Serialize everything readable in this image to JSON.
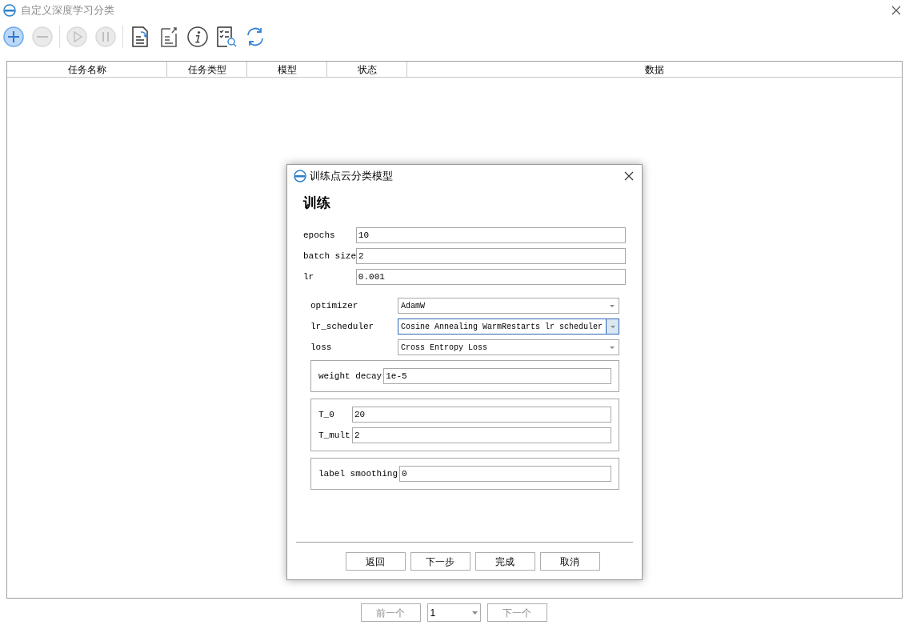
{
  "window": {
    "title": "自定义深度学习分类"
  },
  "toolbar": [
    {
      "kind": "add",
      "disabled": false
    },
    {
      "kind": "remove",
      "disabled": true
    },
    {
      "kind": "sep"
    },
    {
      "kind": "play",
      "disabled": true
    },
    {
      "kind": "pause",
      "disabled": true
    },
    {
      "kind": "sep"
    },
    {
      "kind": "import",
      "disabled": false
    },
    {
      "kind": "export",
      "disabled": false
    },
    {
      "kind": "info",
      "disabled": false
    },
    {
      "kind": "review",
      "disabled": false
    },
    {
      "kind": "refresh",
      "disabled": false
    }
  ],
  "table": {
    "columns": [
      "任务名称",
      "任务类型",
      "模型",
      "状态",
      "数据"
    ]
  },
  "pagination": {
    "prev": "前一个",
    "page": "1",
    "next": "下一个"
  },
  "dialog": {
    "title": "训练点云分类模型",
    "heading": "训练",
    "fields": [
      {
        "label": "epochs",
        "value": "10"
      },
      {
        "label": "batch size",
        "value": "2"
      },
      {
        "label": "lr",
        "value": "0.001"
      }
    ],
    "combos": [
      {
        "label": "optimizer",
        "value": "AdamW",
        "focused": false
      },
      {
        "label": "lr_scheduler",
        "value": "Cosine Annealing WarmRestarts lr scheduler",
        "focused": true
      },
      {
        "label": "loss",
        "value": "Cross Entropy Loss",
        "focused": false
      }
    ],
    "groups": [
      {
        "fields": [
          {
            "label": "weight decay",
            "value": "1e-5"
          }
        ]
      },
      {
        "fields": [
          {
            "label": "T_0",
            "value": "20"
          },
          {
            "label": "T_mult",
            "value": "2"
          }
        ]
      },
      {
        "fields": [
          {
            "label": "label smoothing",
            "value": "0"
          }
        ]
      }
    ],
    "buttons": [
      "返回",
      "下一步",
      "完成",
      "取消"
    ]
  }
}
